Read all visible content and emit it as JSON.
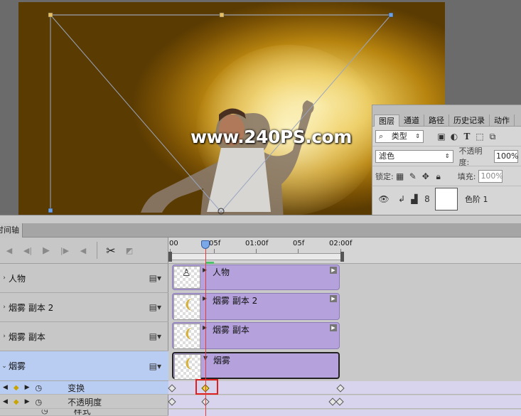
{
  "canvas": {
    "watermark": "www.240PS.com"
  },
  "layers_panel": {
    "tabs": [
      "图层",
      "通道",
      "路径",
      "历史记录",
      "动作"
    ],
    "filter_kind": "类型",
    "blend_mode": "滤色",
    "opacity_label": "不透明度:",
    "opacity_value": "100%",
    "lock_label": "锁定:",
    "fill_label": "填充:",
    "fill_value": "100%",
    "layer_name": "色阶 1"
  },
  "timeline": {
    "panel_tab": "时间轴",
    "ruler": [
      "00",
      "05f",
      "01:00f",
      "05f",
      "02:00f"
    ],
    "tracks": [
      {
        "label": "人物",
        "clip": "人物"
      },
      {
        "label": "烟雾 副本 2",
        "clip": "烟雾 副本 2"
      },
      {
        "label": "烟雾 副本",
        "clip": "烟雾 副本"
      },
      {
        "label": "烟雾",
        "clip": "烟雾"
      }
    ],
    "properties": [
      "变换",
      "不透明度",
      "样式"
    ]
  },
  "colors": {
    "clip_fill": "#b5a2dc",
    "selected_track": "#b9cdf2",
    "playhead": "#e23b3b",
    "highlight_box": "#e02020"
  }
}
